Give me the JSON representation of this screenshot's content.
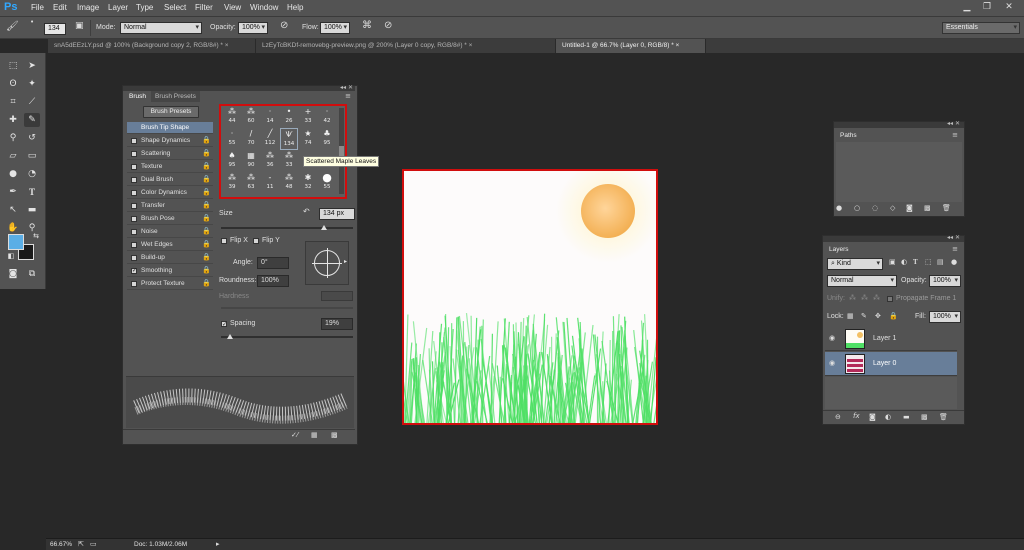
{
  "app": {
    "logo": "Ps"
  },
  "menu": [
    "File",
    "Edit",
    "Image",
    "Layer",
    "Type",
    "Select",
    "Filter",
    "View",
    "Window",
    "Help"
  ],
  "window_controls": {
    "minimize": "▁",
    "restore": "❐",
    "close": "✕"
  },
  "options": {
    "brush_size": "134",
    "mode_label": "Mode:",
    "mode_value": "Normal",
    "opacity_label": "Opacity:",
    "opacity_value": "100%",
    "flow_label": "Flow:",
    "flow_value": "100%",
    "workspace": "Essentials"
  },
  "tabs": [
    {
      "label": "snA5dEEzLY.psd @ 100% (Background copy 2, RGB/8#) *",
      "close": "×"
    },
    {
      "label": "LzEyTcBKDf-removebg-preview.png @ 200% (Layer 0 copy, RGB/8#) *",
      "close": "×"
    },
    {
      "label": "Untitled-1 @ 66.7% (Layer 0, RGB/8) *",
      "close": "×"
    }
  ],
  "brush_panel": {
    "tab_brush": "Brush",
    "tab_presets": "Brush Presets",
    "presets_button": "Brush Presets",
    "options": [
      {
        "label": "Brush Tip Shape",
        "checked": false,
        "active": true
      },
      {
        "label": "Shape Dynamics",
        "checked": false
      },
      {
        "label": "Scattering",
        "checked": false
      },
      {
        "label": "Texture",
        "checked": false
      },
      {
        "label": "Dual Brush",
        "checked": false
      },
      {
        "label": "Color Dynamics",
        "checked": false
      },
      {
        "label": "Transfer",
        "checked": false
      },
      {
        "label": "Brush Pose",
        "checked": false
      },
      {
        "label": "Noise",
        "checked": false
      },
      {
        "label": "Wet Edges",
        "checked": false
      },
      {
        "label": "Build-up",
        "checked": false
      },
      {
        "label": "Smoothing",
        "checked": true
      },
      {
        "label": "Protect Texture",
        "checked": false
      }
    ],
    "tips_row1": [
      "44",
      "60",
      "14",
      "26",
      "33",
      "42"
    ],
    "tips_row2": [
      "55",
      "70",
      "112",
      "134",
      "74",
      "95"
    ],
    "tips_row3": [
      "95",
      "90",
      "36",
      "33",
      "",
      ""
    ],
    "tips_row4": [
      "39",
      "63",
      "11",
      "48",
      "32",
      "55"
    ],
    "tooltip": "Scattered Maple Leaves",
    "size_label": "Size",
    "size_value": "134 px",
    "flip_x": "Flip X",
    "flip_y": "Flip Y",
    "angle_label": "Angle:",
    "angle_value": "0°",
    "roundness_label": "Roundness:",
    "roundness_value": "100%",
    "hardness_label": "Hardness",
    "spacing_label": "Spacing",
    "spacing_value": "19%"
  },
  "paths_panel": {
    "title": "Paths"
  },
  "layers_panel": {
    "title": "Layers",
    "kind": "Kind",
    "blend": "Normal",
    "opacity_label": "Opacity:",
    "opacity_value": "100%",
    "unify_label": "Unify:",
    "propagate": "Propagate Frame 1",
    "lock_label": "Lock:",
    "fill_label": "Fill:",
    "fill_value": "100%",
    "layers": [
      {
        "name": "Layer 1",
        "selected": false
      },
      {
        "name": "Layer 0",
        "selected": true
      }
    ]
  },
  "status": {
    "zoom": "66.67%",
    "doc": "Doc: 1.03M/2.06M"
  },
  "colors": {
    "foreground": "#5aaee6",
    "background": "#1a1a1a",
    "highlight": "#d10d0d",
    "grass": "#4fe065",
    "sun": "#f4c064"
  }
}
